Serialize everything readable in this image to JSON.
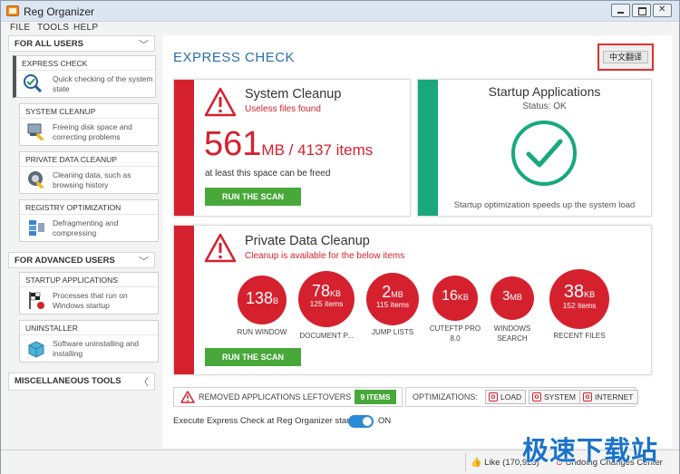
{
  "window": {
    "title": "Reg Organizer"
  },
  "menu": [
    "FILE",
    "TOOLS",
    "HELP"
  ],
  "sidebar": {
    "section_all_users": "FOR ALL USERS",
    "section_advanced": "FOR ADVANCED USERS",
    "section_misc": "MISCELLANEOUS TOOLS",
    "items": [
      {
        "title": "EXPRESS CHECK",
        "desc": "Quick checking of the system state",
        "icon": "magnifier-check-icon"
      },
      {
        "title": "SYSTEM CLEANUP",
        "desc": "Freeing disk space and correcting problems",
        "icon": "broom-cleanup-icon"
      },
      {
        "title": "PRIVATE DATA CLEANUP",
        "desc": "Cleaning data, such as browsing history",
        "icon": "private-data-icon"
      },
      {
        "title": "REGISTRY OPTIMIZATION",
        "desc": "Defragmenting and compressing",
        "icon": "registry-icon"
      },
      {
        "title": "STARTUP APPLICATIONS",
        "desc": "Processes that run on Windows startup",
        "icon": "startup-flag-icon"
      },
      {
        "title": "UNINSTALLER",
        "desc": "Software uninstalling and installing",
        "icon": "uninstaller-box-icon"
      }
    ]
  },
  "main": {
    "title": "EXPRESS CHECK",
    "translate_button": "中文翻译",
    "system_cleanup": {
      "title": "System Cleanup",
      "subtitle": "Useless files found",
      "size_value": "561",
      "size_rest": "MB / 4137 items",
      "note": "at least this space can be freed",
      "button": "RUN THE SCAN"
    },
    "startup": {
      "title": "Startup Applications",
      "status": "Status: OK",
      "note": "Startup optimization speeds up the system load"
    },
    "private": {
      "title": "Private Data Cleanup",
      "subtitle": "Cleanup is available for the below items",
      "button": "RUN THE SCAN",
      "bubbles": [
        {
          "value": "138",
          "unit": "B",
          "items": "",
          "label": "RUN WINDOW"
        },
        {
          "value": "78",
          "unit": "KB",
          "items": "125 items",
          "label": "DOCUMENT P..."
        },
        {
          "value": "2",
          "unit": "MB",
          "items": "115 items",
          "label": "JUMP LISTS"
        },
        {
          "value": "16",
          "unit": "KB",
          "items": "",
          "label": "CUTEFTP PRO 8.0"
        },
        {
          "value": "3",
          "unit": "MB",
          "items": "",
          "label": "WINDOWS SEARCH"
        },
        {
          "value": "38",
          "unit": "KB",
          "items": "152 items",
          "label": "RECENT FILES"
        }
      ]
    },
    "removed": {
      "label": "REMOVED APPLICATIONS LEFTOVERS",
      "badge": "9 ITEMS"
    },
    "optimizations": {
      "label": "OPTIMIZATIONS:",
      "buttons": [
        "LOAD",
        "SYSTEM",
        "INTERNET"
      ]
    },
    "startup_toggle": {
      "label": "Execute Express Check at Reg Organizer startup",
      "state": "ON"
    }
  },
  "status": {
    "like": "Like (170,923)",
    "undo": "Undoing Changes Center"
  },
  "watermark": "极速下载站",
  "colors": {
    "red": "#d5212e",
    "green": "#17a97b",
    "button_green": "#48a83a",
    "accent": "#2b6fa6"
  }
}
